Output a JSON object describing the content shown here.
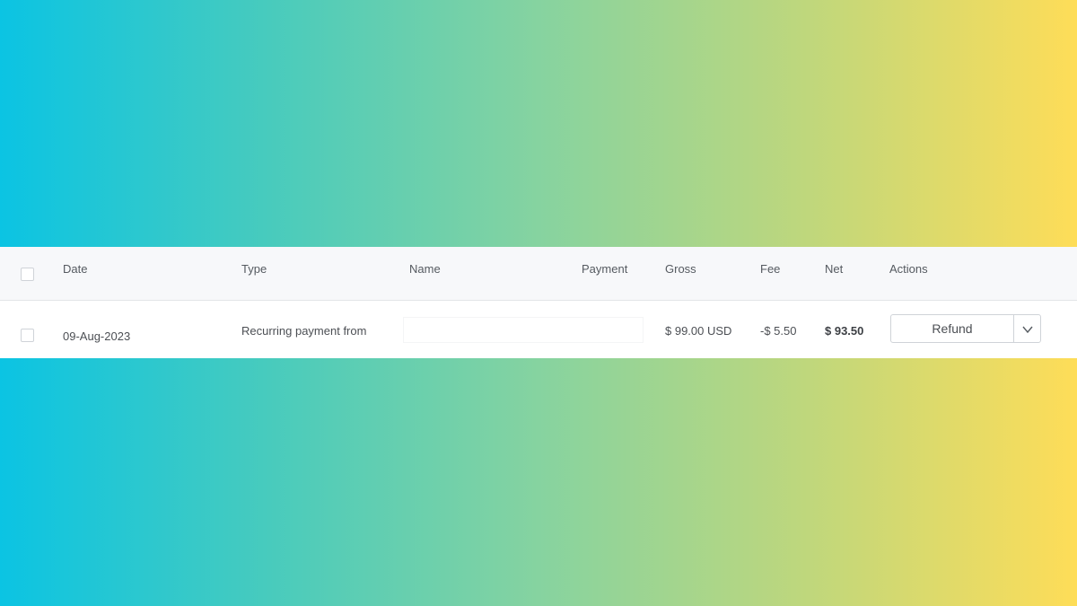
{
  "table": {
    "headers": {
      "date": "Date",
      "type": "Type",
      "name": "Name",
      "payment": "Payment",
      "gross": "Gross",
      "fee": "Fee",
      "net": "Net",
      "actions": "Actions"
    },
    "rows": [
      {
        "date": "09-Aug-2023",
        "type": "Recurring payment from",
        "name": "",
        "payment": "",
        "gross": "$ 99.00 USD",
        "fee": "-$ 5.50",
        "net": "$ 93.50",
        "action_label": "Refund",
        "action_menu_icon": "chevron-down-icon"
      }
    ]
  },
  "colors": {
    "gradient_left": "#0bc4e3",
    "gradient_right": "#fedd58",
    "header_bg": "#f7f8fa",
    "row_bg": "#ffffff"
  }
}
